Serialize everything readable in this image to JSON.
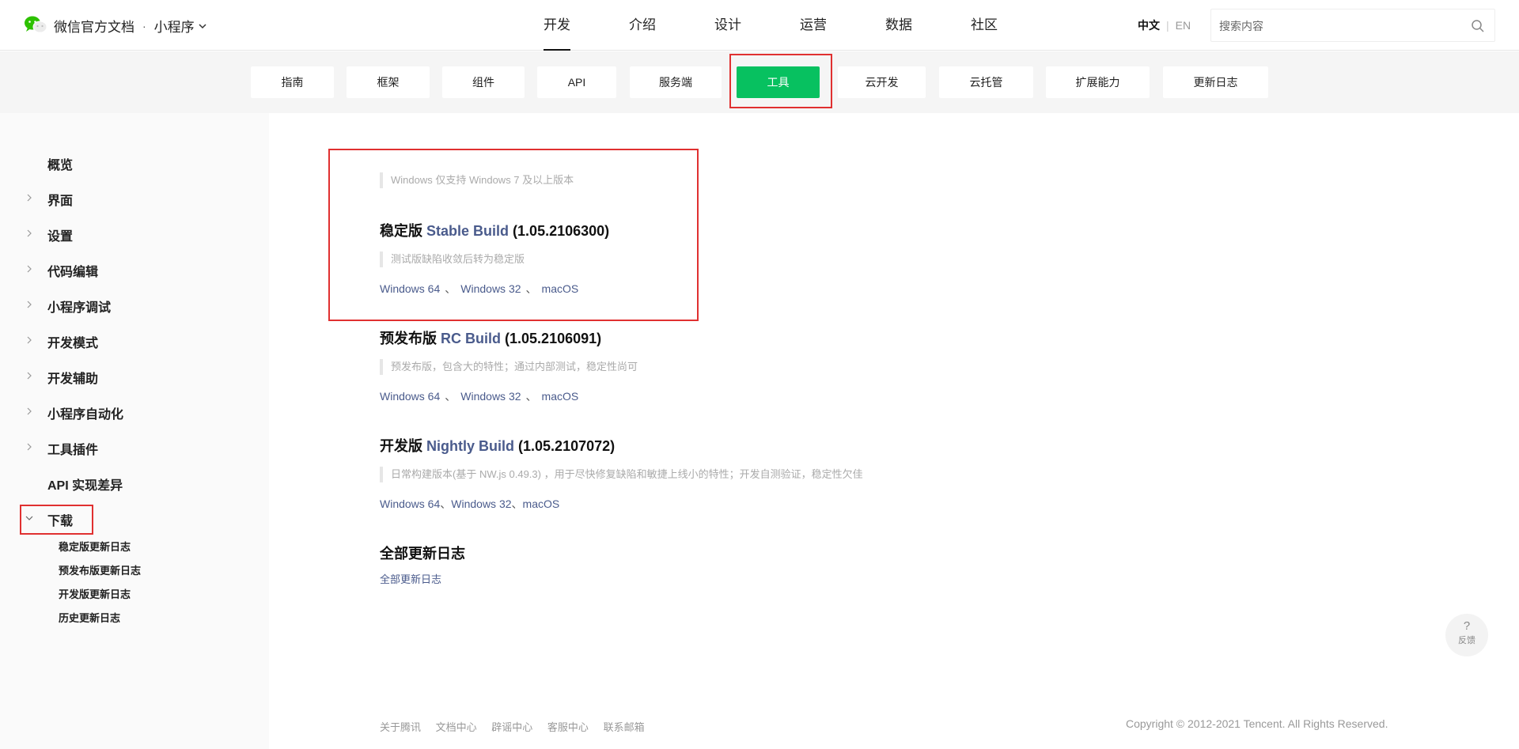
{
  "header": {
    "brand_title": "微信官方文档",
    "brand_dot": "·",
    "brand_product": "小程序",
    "nav": [
      "开发",
      "介绍",
      "设计",
      "运营",
      "数据",
      "社区"
    ],
    "active_nav": "开发",
    "lang_zh": "中文",
    "lang_sep": "|",
    "lang_en": "EN",
    "search_placeholder": "搜索内容"
  },
  "subnav": {
    "tabs": [
      "指南",
      "框架",
      "组件",
      "API",
      "服务端",
      "工具",
      "云开发",
      "云托管",
      "扩展能力",
      "更新日志"
    ],
    "active_tab": "工具",
    "accent_color": "#07c160"
  },
  "sidebar": {
    "items": [
      "概览",
      "界面",
      "设置",
      "代码编辑",
      "小程序调试",
      "开发模式",
      "开发辅助",
      "小程序自动化",
      "工具插件",
      "API 实现差异",
      "下载"
    ],
    "sub_items": [
      "稳定版更新日志",
      "预发布版更新日志",
      "开发版更新日志",
      "历史更新日志"
    ]
  },
  "content": {
    "windows_note": "Windows 仅支持 Windows 7 及以上版本",
    "stable": {
      "title_cn": "稳定版",
      "title_en": "Stable Build",
      "version": "(1.05.2106300)",
      "note": "测试版缺陷收敛后转为稳定版",
      "links": [
        "Windows 64",
        "Windows 32",
        "macOS"
      ]
    },
    "rc": {
      "title_cn": "预发布版",
      "title_en": "RC Build",
      "version": "(1.05.2106091)",
      "note": "预发布版，包含大的特性；通过内部测试，稳定性尚可",
      "links": [
        "Windows 64",
        "Windows 32",
        "macOS"
      ]
    },
    "nightly": {
      "title_cn": "开发版",
      "title_en": "Nightly Build",
      "version": "(1.05.2107072)",
      "note": "日常构建版本(基于 NW.js 0.49.3) ，用于尽快修复缺陷和敏捷上线小的特性；开发自测验证，稳定性欠佳",
      "links": [
        "Windows 64",
        "Windows 32",
        "macOS"
      ]
    },
    "changelog": {
      "title": "全部更新日志",
      "link": "全部更新日志"
    },
    "link_sep": "、"
  },
  "footer": {
    "links": [
      "关于腾讯",
      "文档中心",
      "辟谣中心",
      "客服中心",
      "联系邮箱"
    ],
    "copyright": "Copyright © 2012-2021 Tencent. All Rights Reserved."
  },
  "feedback": {
    "symbol": "?",
    "label": "反馈"
  }
}
